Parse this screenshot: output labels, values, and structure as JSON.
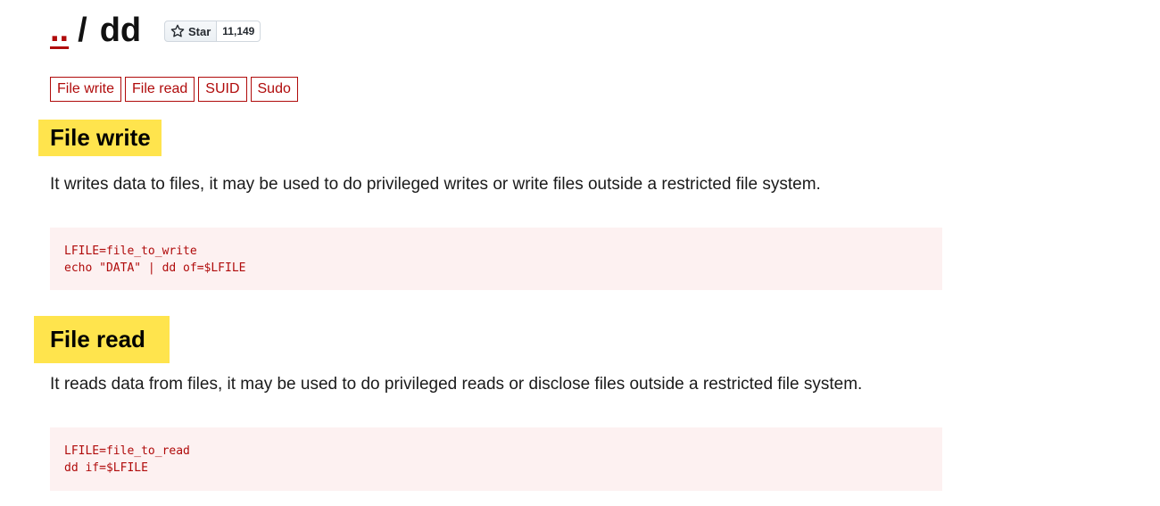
{
  "header": {
    "home_link": "..",
    "separator": "/",
    "title": "dd"
  },
  "star": {
    "label": "Star",
    "count": "11,149"
  },
  "tags": [
    "File write",
    "File read",
    "SUID",
    "Sudo"
  ],
  "sections": {
    "file_write": {
      "heading": "File write",
      "description": "It writes data to files, it may be used to do privileged writes or write files outside a restricted file system.",
      "code": [
        "LFILE=file_to_write",
        "echo \"DATA\" | dd of=$LFILE"
      ]
    },
    "file_read": {
      "heading": "File read",
      "description": "It reads data from files, it may be used to do privileged reads or disclose files outside a restricted file system.",
      "code": [
        "LFILE=file_to_read",
        "dd if=$LFILE"
      ]
    }
  },
  "colors": {
    "accent": "#b00b0b",
    "highlight": "#ffe44d",
    "code_bg": "#fdf1f1"
  }
}
